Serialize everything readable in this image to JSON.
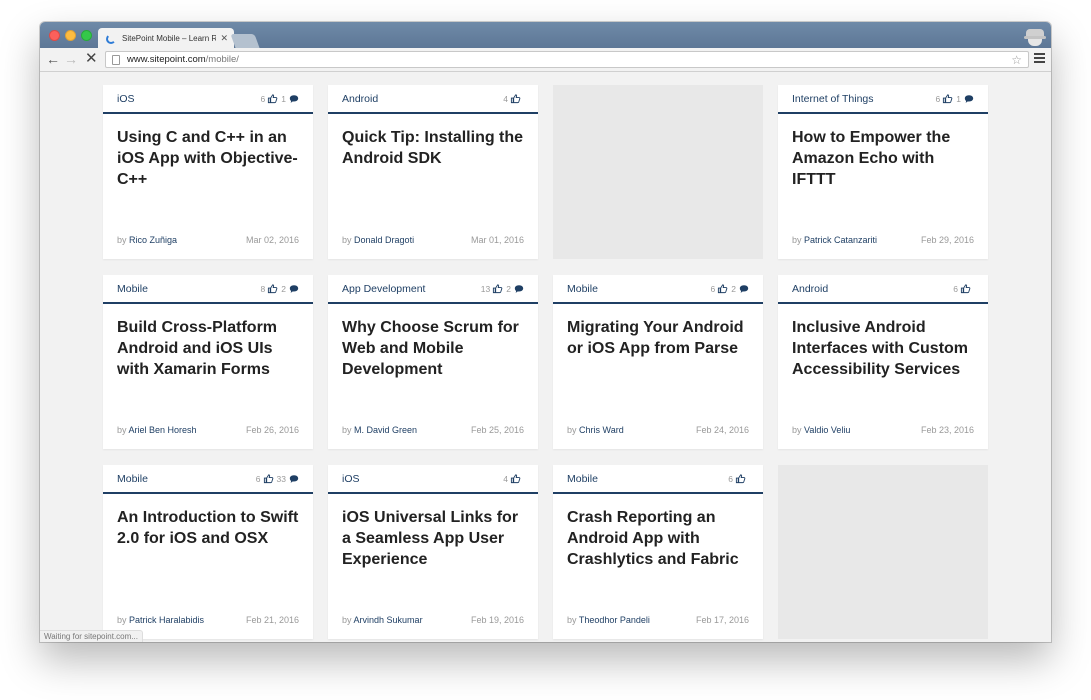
{
  "browser": {
    "tab_title": "SitePoint Mobile – Learn Re",
    "tab_close": "✕",
    "url_host": "www.sitepoint.com",
    "url_path": "/mobile/",
    "status_text": "Waiting for sitepoint.com..."
  },
  "cards": [
    {
      "category": "iOS",
      "likes": "6",
      "comments": "1",
      "title": "Using C and C++ in an iOS App with Objective-C++",
      "by": "by",
      "author": "Rico Zuñiga",
      "date": "Mar 02, 2016"
    },
    {
      "category": "Android",
      "likes": "4",
      "comments": "",
      "title": "Quick Tip: Installing the Android SDK",
      "by": "by",
      "author": "Donald Dragoti",
      "date": "Mar 01, 2016"
    },
    {
      "category": "Internet of Things",
      "likes": "6",
      "comments": "1",
      "title": "How to Empower the Amazon Echo with IFTTT",
      "by": "by",
      "author": "Patrick Catanzariti",
      "date": "Feb 29, 2016"
    },
    {
      "category": "Mobile",
      "likes": "8",
      "comments": "2",
      "title": "Build Cross-Platform Android and iOS UIs with Xamarin Forms",
      "by": "by",
      "author": "Ariel Ben Horesh",
      "date": "Feb 26, 2016"
    },
    {
      "category": "App Development",
      "likes": "13",
      "comments": "2",
      "title": "Why Choose Scrum for Web and Mobile Development",
      "by": "by",
      "author": "M. David Green",
      "date": "Feb 25, 2016"
    },
    {
      "category": "Mobile",
      "likes": "6",
      "comments": "2",
      "title": "Migrating Your Android or iOS App from Parse",
      "by": "by",
      "author": "Chris Ward",
      "date": "Feb 24, 2016"
    },
    {
      "category": "Android",
      "likes": "6",
      "comments": "",
      "title": "Inclusive Android Interfaces with Custom Accessibility Services",
      "by": "by",
      "author": "Valdio Veliu",
      "date": "Feb 23, 2016"
    },
    {
      "category": "Mobile",
      "likes": "6",
      "comments": "33",
      "title": "An Introduction to Swift 2.0 for iOS and OSX",
      "by": "by",
      "author": "Patrick Haralabidis",
      "date": "Feb 21, 2016"
    },
    {
      "category": "iOS",
      "likes": "4",
      "comments": "",
      "title": "iOS Universal Links for a Seamless App User Experience",
      "by": "by",
      "author": "Arvindh Sukumar",
      "date": "Feb 19, 2016"
    },
    {
      "category": "Mobile",
      "likes": "6",
      "comments": "",
      "title": "Crash Reporting an Android App with Crashlytics and Fabric",
      "by": "by",
      "author": "Theodhor Pandeli",
      "date": "Feb 17, 2016"
    }
  ],
  "colors": {
    "accent": "#1f3f64",
    "titlebar": "#5d7796",
    "page_bg": "#f2f2f2",
    "placeholder": "#e8e8e8"
  }
}
